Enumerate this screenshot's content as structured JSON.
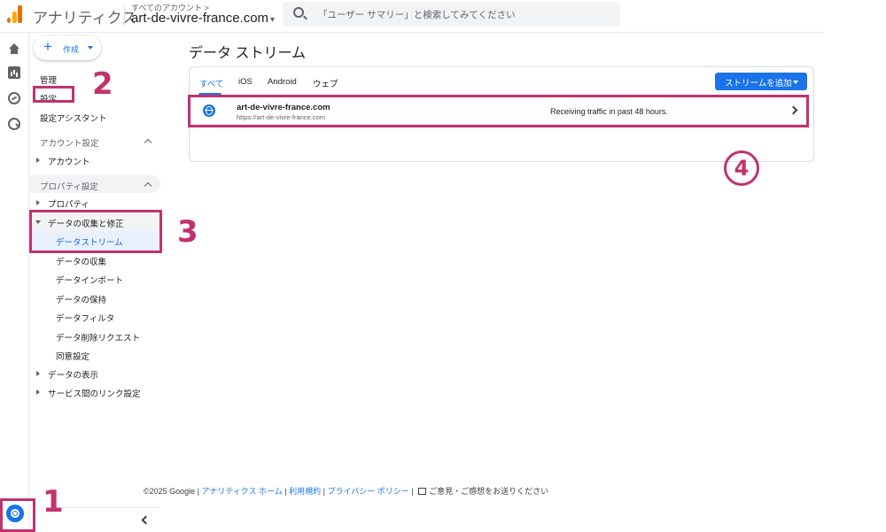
{
  "header": {
    "app_name": "アナリティクス",
    "account_breadcrumb": "すべてのアカウント >",
    "property_name": "art-de-vivre-france.com",
    "search_placeholder": "「ユーザー サマリー」と検索してみてください"
  },
  "nav": {
    "create_label": "作成",
    "admin": "管理",
    "settings": "設定",
    "setup_assistant": "設定アシスタント",
    "account_section": "アカウント設定",
    "account_item": "アカウント",
    "property_section": "プロパティ設定",
    "property_item": "プロパティ",
    "data_collection_group": "データの収集と修正",
    "sub_items": [
      "データストリーム",
      "データの収集",
      "データインポート",
      "データの保持",
      "データフィルタ",
      "データ削除リクエスト",
      "同意設定"
    ],
    "data_display": "データの表示",
    "product_links": "サービス間のリンク設定"
  },
  "main": {
    "title": "データ ストリーム",
    "tabs": [
      "すべて",
      "iOS",
      "Android",
      "ウェブ"
    ],
    "add_stream_label": "ストリームを追加",
    "stream": {
      "name": "art-de-vivre-france.com",
      "url": "https://art-de-vivre-france.com",
      "status": "Receiving traffic in past 48 hours."
    }
  },
  "footer": {
    "copyright": "©2025 Google | ",
    "home": "アナリティクス ホーム",
    "sep1": " | ",
    "terms": "利用規約",
    "sep2": " | ",
    "privacy": "プライバシー ポリシー",
    "sep3": " | ",
    "feedback": "ご意見・ご感想をお送りください"
  },
  "annotations": [
    "1",
    "2",
    "3",
    "4"
  ],
  "colors": {
    "accent": "#1a73e8",
    "annotation": "#c2326f"
  }
}
